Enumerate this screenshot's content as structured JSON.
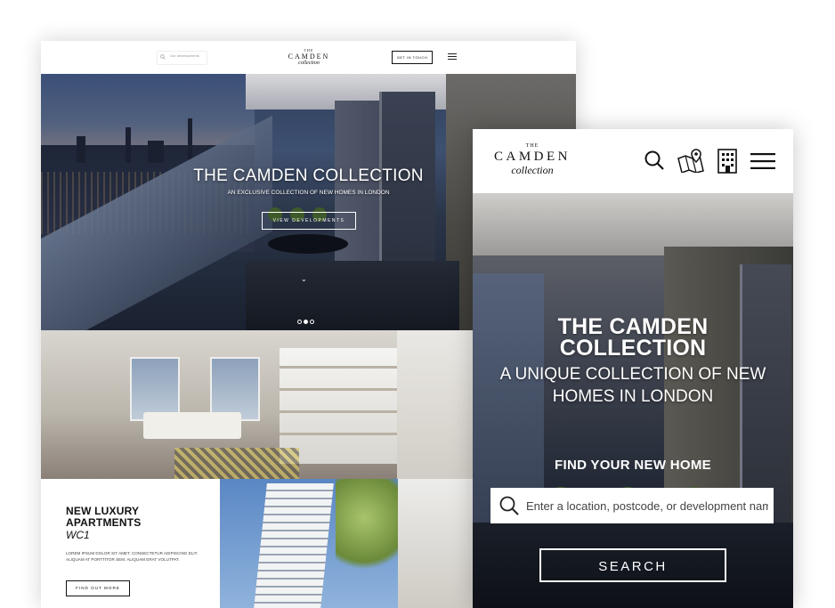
{
  "desktop": {
    "header": {
      "search_placeholder": "Our developments",
      "logo_the": "THE",
      "logo_main": "CAMDEN",
      "logo_sub": "collection",
      "cta_label": "GET IN TOUCH"
    },
    "hero": {
      "title": "THE CAMDEN COLLECTION",
      "subtitle": "AN EXCLUSIVE COLLECTION OF NEW HOMES IN LONDON",
      "button_label": "VIEW DEVELOPMENTS"
    },
    "card": {
      "title": "NEW LUXURY APARTMENTS",
      "location": "WC1",
      "body": "LOREM IPSUM DOLOR SIT AMET, CONSECTETUR ADIPISCING ELIT. ALIQUAM AT PORTTITOR SEM. ALIQUAM ERAT VOLUTPAT.",
      "button_label": "FIND OUT MORE"
    }
  },
  "mobile": {
    "header": {
      "logo_the": "THE",
      "logo_main": "CAMDEN",
      "logo_sub": "collection"
    },
    "hero": {
      "title_line1": "THE CAMDEN",
      "title_line2": "COLLECTION",
      "sub_line1": "A UNIQUE COLLECTION OF NEW",
      "sub_line2": "HOMES IN LONDON",
      "find_label": "FIND YOUR NEW HOME",
      "search_placeholder": "Enter a location, postcode, or development name",
      "search_button": "SEARCH"
    }
  },
  "icons": [
    "search-icon",
    "map-pin-icon",
    "building-icon",
    "menu-icon",
    "chevron-down-icon"
  ],
  "colors": {
    "accent": "#ffffff",
    "text": "#111111"
  }
}
